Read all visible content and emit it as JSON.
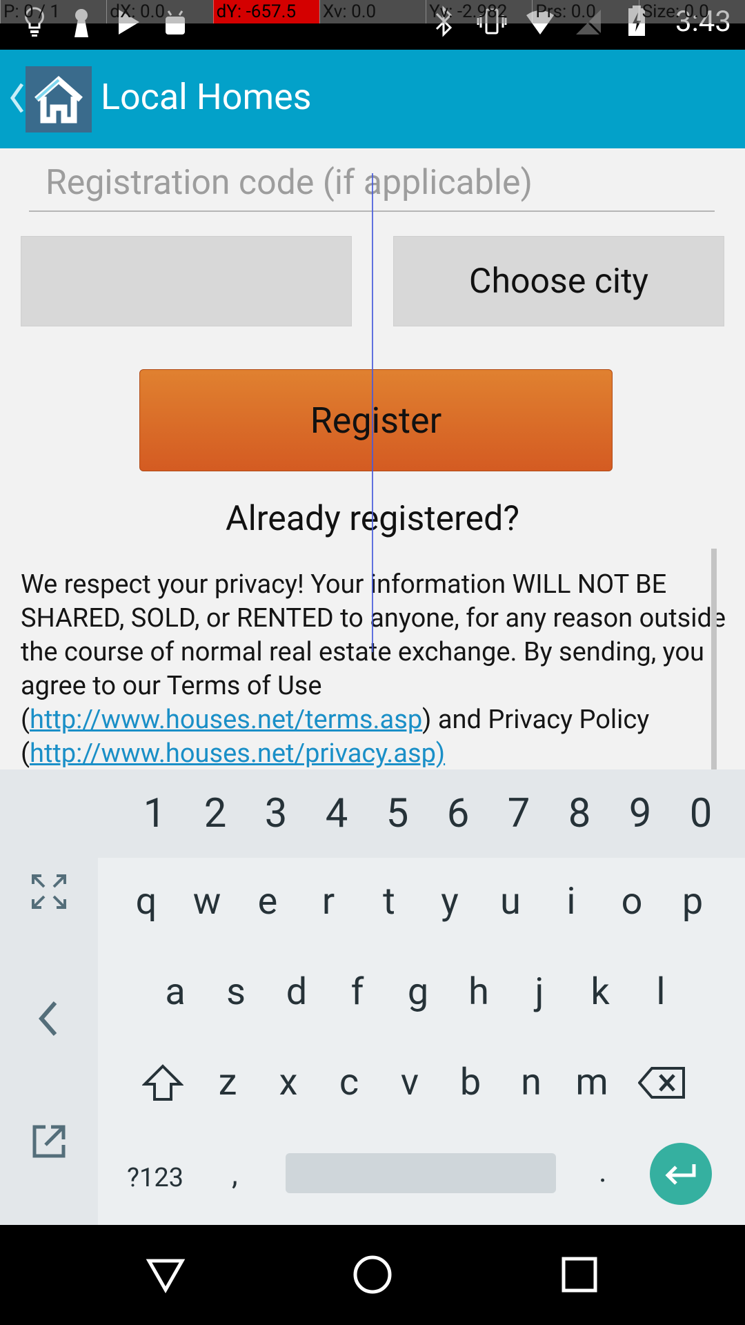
{
  "status_bar": {
    "pointer_readout": [
      "P: 0 / 1",
      "dX: 0.0",
      "dY: -657.5",
      "Xv: 0.0",
      "Yv: -2.982",
      "Prs: 0.0",
      "Size: 0.0"
    ],
    "time": "3:43",
    "left_icons": [
      "lightbulb-icon",
      "keyhole-icon",
      "play-store-icon",
      "android-icon"
    ],
    "right_icons": [
      "bluetooth-icon",
      "vibrate-icon",
      "wifi-icon",
      "no-signal-icon",
      "battery-charging-icon"
    ]
  },
  "app_bar": {
    "title": "Local Homes",
    "logo_icon": "house-icon",
    "background": "#03a1c9"
  },
  "form": {
    "registration_placeholder": "Registration code (if applicable)",
    "registration_value": "",
    "state_spinner_value": "",
    "city_spinner_label": "Choose city",
    "register_button": "Register",
    "already_registered": "Already registered?",
    "privacy_text_1": "We respect your privacy! Your information WILL NOT BE SHARED, SOLD, or RENTED to anyone, for any reason outside the course of normal real estate exchange. By sending, you agree to our Terms of Use (",
    "terms_link": "http://www.houses.net/terms.asp",
    "privacy_text_2": ") and Privacy Policy (",
    "privacy_link": "http://www.houses.net/privacy.asp)"
  },
  "keyboard": {
    "number_row": [
      "1",
      "2",
      "3",
      "4",
      "5",
      "6",
      "7",
      "8",
      "9",
      "0"
    ],
    "row1": [
      "q",
      "w",
      "e",
      "r",
      "t",
      "y",
      "u",
      "i",
      "o",
      "p"
    ],
    "row2": [
      "a",
      "s",
      "d",
      "f",
      "g",
      "h",
      "j",
      "k",
      "l"
    ],
    "row3": [
      "z",
      "x",
      "c",
      "v",
      "b",
      "n",
      "m"
    ],
    "symbols_key": "?123",
    "comma_key": ",",
    "period_key": ".",
    "accent_color": "#35b0a0"
  },
  "nav_bar": {
    "buttons": [
      "back-icon",
      "home-icon",
      "recents-icon"
    ]
  }
}
